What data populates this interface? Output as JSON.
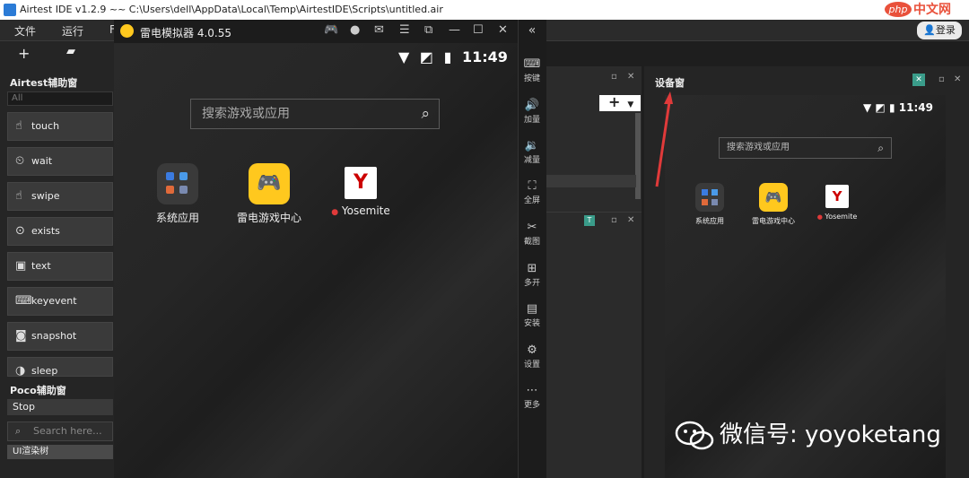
{
  "window": {
    "title": "Airtest IDE v1.2.9 ~~ C:\\Users\\dell\\AppData\\Local\\Temp\\AirtestIDE\\Scripts\\untitled.air"
  },
  "site_logo": {
    "oval": "php",
    "text": "中文网"
  },
  "menu": {
    "items": [
      "文件",
      "运行",
      "F"
    ],
    "login": "登录"
  },
  "airtest_panel": {
    "title": "Airtest辅助窗",
    "filter_placeholder": "All",
    "buttons": [
      "touch",
      "wait",
      "swipe",
      "exists",
      "text",
      "keyevent",
      "snapshot",
      "sleep"
    ]
  },
  "poco_panel": {
    "title": "Poco辅助窗",
    "mode": "Stop",
    "search_placeholder": "Search here...",
    "tree_item": "UI渲染树"
  },
  "emulator": {
    "title": "雷电模拟器 4.0.55",
    "time": "11:49",
    "search_placeholder": "搜索游戏或应用",
    "apps": [
      "系统应用",
      "雷电游戏中心",
      "Yosemite"
    ],
    "sidebar": [
      "按键",
      "加量",
      "减量",
      "全屏",
      "截图",
      "多开",
      "安装",
      "设置",
      "更多"
    ]
  },
  "device_pane": {
    "title": "设备窗",
    "time": "11:49",
    "search_placeholder": "搜索游戏或应用",
    "apps": [
      "系统应用",
      "雷电游戏中心",
      "Yosemite"
    ]
  },
  "watermark": {
    "text": "微信号: yoyoketang"
  },
  "colors": {
    "accent_red": "#e03a3a",
    "leidian_yellow": "#ffc81e",
    "php_red": "#e9513b"
  }
}
